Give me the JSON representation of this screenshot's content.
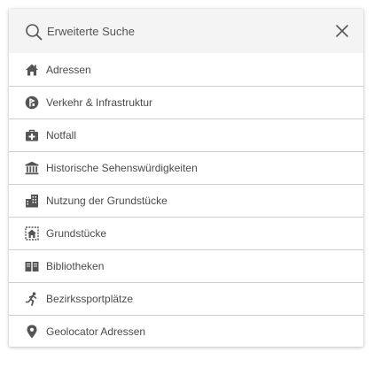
{
  "search": {
    "placeholder": "Erweiterte Suche",
    "value": ""
  },
  "colors": {
    "icon": "#555555",
    "text": "#4a4a4a",
    "search_bg": "#f4f4f4",
    "divider": "#cfcfcf"
  },
  "items": [
    {
      "label": "Adressen",
      "icon": "home-icon"
    },
    {
      "label": "Verkehr & Infrastruktur",
      "icon": "traffic-icon"
    },
    {
      "label": "Notfall",
      "icon": "first-aid-kit-icon"
    },
    {
      "label": "Historische Sehenswürdigkeiten",
      "icon": "museum-icon"
    },
    {
      "label": "Nutzung der Grundstücke",
      "icon": "buildings-icon"
    },
    {
      "label": "Grundstücke",
      "icon": "parcel-icon"
    },
    {
      "label": "Bibliotheken",
      "icon": "book-icon"
    },
    {
      "label": "Bezirkssportplätze",
      "icon": "runner-icon"
    },
    {
      "label": "Geolocator Adressen",
      "icon": "map-marker-icon"
    }
  ]
}
